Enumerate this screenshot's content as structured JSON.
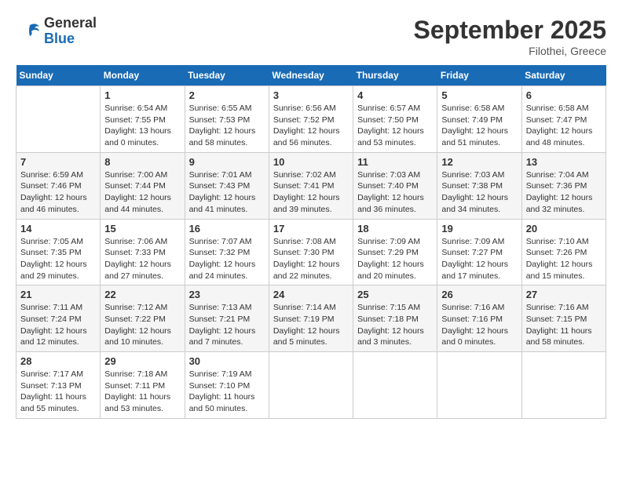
{
  "header": {
    "logo_general": "General",
    "logo_blue": "Blue",
    "month_year": "September 2025",
    "location": "Filothei, Greece"
  },
  "days_of_week": [
    "Sunday",
    "Monday",
    "Tuesday",
    "Wednesday",
    "Thursday",
    "Friday",
    "Saturday"
  ],
  "weeks": [
    [
      {
        "day": "",
        "info": ""
      },
      {
        "day": "1",
        "info": "Sunrise: 6:54 AM\nSunset: 7:55 PM\nDaylight: 13 hours\nand 0 minutes."
      },
      {
        "day": "2",
        "info": "Sunrise: 6:55 AM\nSunset: 7:53 PM\nDaylight: 12 hours\nand 58 minutes."
      },
      {
        "day": "3",
        "info": "Sunrise: 6:56 AM\nSunset: 7:52 PM\nDaylight: 12 hours\nand 56 minutes."
      },
      {
        "day": "4",
        "info": "Sunrise: 6:57 AM\nSunset: 7:50 PM\nDaylight: 12 hours\nand 53 minutes."
      },
      {
        "day": "5",
        "info": "Sunrise: 6:58 AM\nSunset: 7:49 PM\nDaylight: 12 hours\nand 51 minutes."
      },
      {
        "day": "6",
        "info": "Sunrise: 6:58 AM\nSunset: 7:47 PM\nDaylight: 12 hours\nand 48 minutes."
      }
    ],
    [
      {
        "day": "7",
        "info": "Sunrise: 6:59 AM\nSunset: 7:46 PM\nDaylight: 12 hours\nand 46 minutes."
      },
      {
        "day": "8",
        "info": "Sunrise: 7:00 AM\nSunset: 7:44 PM\nDaylight: 12 hours\nand 44 minutes."
      },
      {
        "day": "9",
        "info": "Sunrise: 7:01 AM\nSunset: 7:43 PM\nDaylight: 12 hours\nand 41 minutes."
      },
      {
        "day": "10",
        "info": "Sunrise: 7:02 AM\nSunset: 7:41 PM\nDaylight: 12 hours\nand 39 minutes."
      },
      {
        "day": "11",
        "info": "Sunrise: 7:03 AM\nSunset: 7:40 PM\nDaylight: 12 hours\nand 36 minutes."
      },
      {
        "day": "12",
        "info": "Sunrise: 7:03 AM\nSunset: 7:38 PM\nDaylight: 12 hours\nand 34 minutes."
      },
      {
        "day": "13",
        "info": "Sunrise: 7:04 AM\nSunset: 7:36 PM\nDaylight: 12 hours\nand 32 minutes."
      }
    ],
    [
      {
        "day": "14",
        "info": "Sunrise: 7:05 AM\nSunset: 7:35 PM\nDaylight: 12 hours\nand 29 minutes."
      },
      {
        "day": "15",
        "info": "Sunrise: 7:06 AM\nSunset: 7:33 PM\nDaylight: 12 hours\nand 27 minutes."
      },
      {
        "day": "16",
        "info": "Sunrise: 7:07 AM\nSunset: 7:32 PM\nDaylight: 12 hours\nand 24 minutes."
      },
      {
        "day": "17",
        "info": "Sunrise: 7:08 AM\nSunset: 7:30 PM\nDaylight: 12 hours\nand 22 minutes."
      },
      {
        "day": "18",
        "info": "Sunrise: 7:09 AM\nSunset: 7:29 PM\nDaylight: 12 hours\nand 20 minutes."
      },
      {
        "day": "19",
        "info": "Sunrise: 7:09 AM\nSunset: 7:27 PM\nDaylight: 12 hours\nand 17 minutes."
      },
      {
        "day": "20",
        "info": "Sunrise: 7:10 AM\nSunset: 7:26 PM\nDaylight: 12 hours\nand 15 minutes."
      }
    ],
    [
      {
        "day": "21",
        "info": "Sunrise: 7:11 AM\nSunset: 7:24 PM\nDaylight: 12 hours\nand 12 minutes."
      },
      {
        "day": "22",
        "info": "Sunrise: 7:12 AM\nSunset: 7:22 PM\nDaylight: 12 hours\nand 10 minutes."
      },
      {
        "day": "23",
        "info": "Sunrise: 7:13 AM\nSunset: 7:21 PM\nDaylight: 12 hours\nand 7 minutes."
      },
      {
        "day": "24",
        "info": "Sunrise: 7:14 AM\nSunset: 7:19 PM\nDaylight: 12 hours\nand 5 minutes."
      },
      {
        "day": "25",
        "info": "Sunrise: 7:15 AM\nSunset: 7:18 PM\nDaylight: 12 hours\nand 3 minutes."
      },
      {
        "day": "26",
        "info": "Sunrise: 7:16 AM\nSunset: 7:16 PM\nDaylight: 12 hours\nand 0 minutes."
      },
      {
        "day": "27",
        "info": "Sunrise: 7:16 AM\nSunset: 7:15 PM\nDaylight: 11 hours\nand 58 minutes."
      }
    ],
    [
      {
        "day": "28",
        "info": "Sunrise: 7:17 AM\nSunset: 7:13 PM\nDaylight: 11 hours\nand 55 minutes."
      },
      {
        "day": "29",
        "info": "Sunrise: 7:18 AM\nSunset: 7:11 PM\nDaylight: 11 hours\nand 53 minutes."
      },
      {
        "day": "30",
        "info": "Sunrise: 7:19 AM\nSunset: 7:10 PM\nDaylight: 11 hours\nand 50 minutes."
      },
      {
        "day": "",
        "info": ""
      },
      {
        "day": "",
        "info": ""
      },
      {
        "day": "",
        "info": ""
      },
      {
        "day": "",
        "info": ""
      }
    ]
  ]
}
